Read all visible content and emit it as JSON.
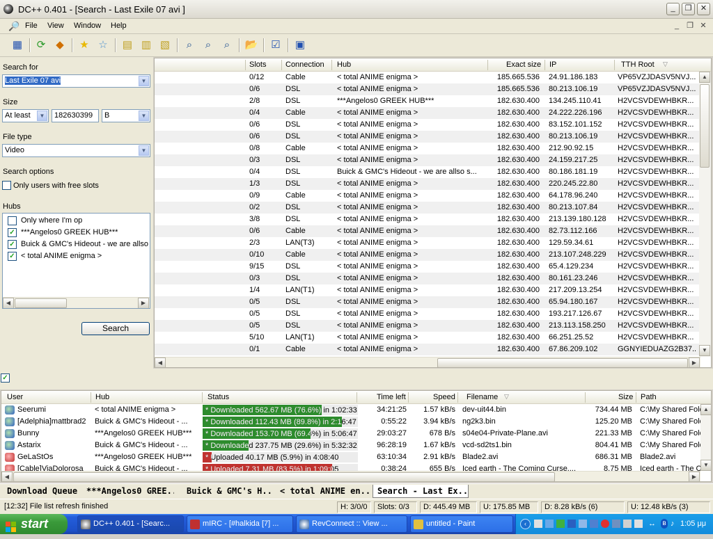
{
  "window": {
    "title": "DC++ 0.401 - [Search - Last Exile 07 avi ]"
  },
  "menu": [
    "File",
    "View",
    "Window",
    "Help"
  ],
  "toolbar_icons": [
    "public-hubs-icon",
    "reconnect-icon",
    "follow-redirect-icon",
    "favorite-hubs-icon",
    "favorite-users-icon",
    "download-queue-icon",
    "finished-downloads-icon",
    "finished-uploads-icon",
    "search-icon",
    "adl-search-icon",
    "search-spy-icon",
    "open-file-list-icon",
    "settings-icon",
    "notepad-icon"
  ],
  "search": {
    "search_for_label": "Search for",
    "search_for_value": "Last Exile 07 avi",
    "size_label": "Size",
    "size_mode": "At least",
    "size_value": "182630399",
    "size_unit": "B",
    "file_type_label": "File type",
    "file_type_value": "Video",
    "options_label": "Search options",
    "free_slots_label": "Only users with free slots",
    "hubs_label": "Hubs",
    "hubs": [
      {
        "label": "Only where I'm op",
        "checked": false
      },
      {
        "label": "***Angelos0 GREEK HUB***",
        "checked": true
      },
      {
        "label": "Buick & GMC's Hideout    -  we are allso",
        "checked": true
      },
      {
        "label": "< total ANIME enigma >",
        "checked": true
      }
    ],
    "search_button": "Search"
  },
  "results": {
    "columns": [
      "Slots",
      "Connection",
      "Hub",
      "Exact size",
      "IP",
      "TTH Root"
    ],
    "rows": [
      [
        "0/12",
        "Cable",
        "< total ANIME enigma >",
        "185.665.536",
        "24.91.186.183",
        "VP65VZJDASV5NVJ..."
      ],
      [
        "0/6",
        "DSL",
        "< total ANIME enigma >",
        "185.665.536",
        "80.213.106.19",
        "VP65VZJDASV5NVJ..."
      ],
      [
        "2/8",
        "DSL",
        "***Angelos0 GREEK HUB***",
        "182.630.400",
        "134.245.110.41",
        "H2VCSVDEWHBKR..."
      ],
      [
        "0/4",
        "Cable",
        "< total ANIME enigma >",
        "182.630.400",
        "24.222.226.196",
        "H2VCSVDEWHBKR..."
      ],
      [
        "0/6",
        "DSL",
        "< total ANIME enigma >",
        "182.630.400",
        "83.152.101.152",
        "H2VCSVDEWHBKR..."
      ],
      [
        "0/6",
        "DSL",
        "< total ANIME enigma >",
        "182.630.400",
        "80.213.106.19",
        "H2VCSVDEWHBKR..."
      ],
      [
        "0/8",
        "Cable",
        "< total ANIME enigma >",
        "182.630.400",
        "212.90.92.15",
        "H2VCSVDEWHBKR..."
      ],
      [
        "0/3",
        "DSL",
        "< total ANIME enigma >",
        "182.630.400",
        "24.159.217.25",
        "H2VCSVDEWHBKR..."
      ],
      [
        "0/4",
        "DSL",
        "Buick & GMC's Hideout   -  we are allso s...",
        "182.630.400",
        "80.186.181.19",
        "H2VCSVDEWHBKR..."
      ],
      [
        "1/3",
        "DSL",
        "< total ANIME enigma >",
        "182.630.400",
        "220.245.22.80",
        "H2VCSVDEWHBKR..."
      ],
      [
        "0/9",
        "Cable",
        "< total ANIME enigma >",
        "182.630.400",
        "64.178.96.240",
        "H2VCSVDEWHBKR..."
      ],
      [
        "0/2",
        "DSL",
        "< total ANIME enigma >",
        "182.630.400",
        "80.213.107.84",
        "H2VCSVDEWHBKR..."
      ],
      [
        "3/8",
        "DSL",
        "< total ANIME enigma >",
        "182.630.400",
        "213.139.180.128",
        "H2VCSVDEWHBKR..."
      ],
      [
        "0/6",
        "Cable",
        "< total ANIME enigma >",
        "182.630.400",
        "82.73.112.166",
        "H2VCSVDEWHBKR..."
      ],
      [
        "2/3",
        "LAN(T3)",
        "< total ANIME enigma >",
        "182.630.400",
        "129.59.34.61",
        "H2VCSVDEWHBKR..."
      ],
      [
        "0/10",
        "Cable",
        "< total ANIME enigma >",
        "182.630.400",
        "213.107.248.229",
        "H2VCSVDEWHBKR..."
      ],
      [
        "9/15",
        "DSL",
        "< total ANIME enigma >",
        "182.630.400",
        "65.4.129.234",
        "H2VCSVDEWHBKR..."
      ],
      [
        "0/3",
        "DSL",
        "< total ANIME enigma >",
        "182.630.400",
        "80.161.23.246",
        "H2VCSVDEWHBKR..."
      ],
      [
        "1/4",
        "LAN(T1)",
        "< total ANIME enigma >",
        "182.630.400",
        "217.209.13.254",
        "H2VCSVDEWHBKR..."
      ],
      [
        "0/5",
        "DSL",
        "< total ANIME enigma >",
        "182.630.400",
        "65.94.180.167",
        "H2VCSVDEWHBKR..."
      ],
      [
        "0/5",
        "DSL",
        "< total ANIME enigma >",
        "182.630.400",
        "193.217.126.67",
        "H2VCSVDEWHBKR..."
      ],
      [
        "0/5",
        "DSL",
        "< total ANIME enigma >",
        "182.630.400",
        "213.113.158.250",
        "H2VCSVDEWHBKR..."
      ],
      [
        "5/10",
        "LAN(T1)",
        "< total ANIME enigma >",
        "182.630.400",
        "66.251.25.52",
        "H2VCSVDEWHBKR..."
      ],
      [
        "0/1",
        "Cable",
        "< total ANIME enigma >",
        "182.630.400",
        "67.86.209.102",
        "GGNYIEDUAZG2B37..."
      ]
    ]
  },
  "transfers": {
    "columns": [
      "User",
      "Hub",
      "Status",
      "Time left",
      "Speed",
      "Filename",
      "Size",
      "Path"
    ],
    "rows": [
      {
        "user": "Seerumi",
        "hub": "< total ANIME enigma >",
        "status": "* Downloaded 562.67 MB (76.6%) in 1:02:33",
        "progress": 0.766,
        "kind": "down",
        "time": "34:21:25",
        "speed": "1.57 kB/s",
        "file": "dev-uit44.bin",
        "size": "734.44 MB",
        "path": "C:\\My Shared Fold"
      },
      {
        "user": "[Adelphia]mattbrad2",
        "hub": "Buick & GMC's Hideout    - ...",
        "status": "* Downloaded 112.43 MB (89.8%) in 2:16:47",
        "progress": 0.898,
        "kind": "down",
        "time": "0:55:22",
        "speed": "3.94 kB/s",
        "file": "ng2k3.bin",
        "size": "125.20 MB",
        "path": "C:\\My Shared Fold"
      },
      {
        "user": "Bunny",
        "hub": "***Angelos0 GREEK HUB***",
        "status": "* Downloaded 153.70 MB (69.4%) in 5:06:47",
        "progress": 0.694,
        "kind": "down",
        "time": "29:03:27",
        "speed": "678 B/s",
        "file": "s04e04-Private-Plane.avi",
        "size": "221.33 MB",
        "path": "C:\\My Shared Fold"
      },
      {
        "user": "Astarix",
        "hub": "Buick & GMC's Hideout    - ...",
        "status": "* Downloaded 237.75 MB (29.6%) in 5:32:32",
        "progress": 0.296,
        "kind": "down",
        "time": "96:28:19",
        "speed": "1.67 kB/s",
        "file": "vcd-sd2ts1.bin",
        "size": "804.41 MB",
        "path": "C:\\My Shared Fold"
      },
      {
        "user": "GeLaStOs",
        "hub": "***Angelos0 GREEK HUB***",
        "status": "* Uploaded 40.17 MB (5.9%) in 4:08:40",
        "progress": 0.059,
        "kind": "up",
        "time": "63:10:34",
        "speed": "2.91 kB/s",
        "file": "Blade2.avi",
        "size": "686.31 MB",
        "path": "Blade2.avi"
      },
      {
        "user": "[Cable]ViaDolorosa",
        "hub": "Buick & GMC's Hideout    - ...",
        "status": "* Uploaded 7.31 MB (83.5%) in 1:09:05",
        "progress": 0.835,
        "kind": "up",
        "time": "0:38:24",
        "speed": "655 B/s",
        "file": "Iced earth - The Coming Curse....",
        "size": "8.75 MB",
        "path": "Iced earth - The C"
      }
    ]
  },
  "tabs": [
    "Download Queue",
    "***Angelos0 GREE...",
    "Buick & GMC's H...",
    "< total ANIME en...",
    "Search - Last Ex..."
  ],
  "status": {
    "message": "[12:32] File list refresh finished",
    "hubs": "H: 3/0/0",
    "slots": "Slots: 0/3",
    "downloaded": "D: 445.49 MB",
    "uploaded": "U: 175.85 MB",
    "down_speed": "D: 8.28 kB/s (6)",
    "up_speed": "U: 12.48 kB/s (3)"
  },
  "taskbar": {
    "start": "start",
    "buttons": [
      {
        "label": "DC++ 0.401 - [Searc...",
        "active": true
      },
      {
        "label": "mIRC - [#halkida [7] ...",
        "active": false
      },
      {
        "label": "RevConnect :: View ...",
        "active": false
      },
      {
        "label": "untitled - Paint",
        "active": false
      }
    ],
    "clock": "1:05 μμ"
  },
  "colors": {
    "progress_down": "#2d8c2d",
    "progress_up": "#c0322f",
    "selection": "#316ac5",
    "taskbar": "#245edb"
  }
}
